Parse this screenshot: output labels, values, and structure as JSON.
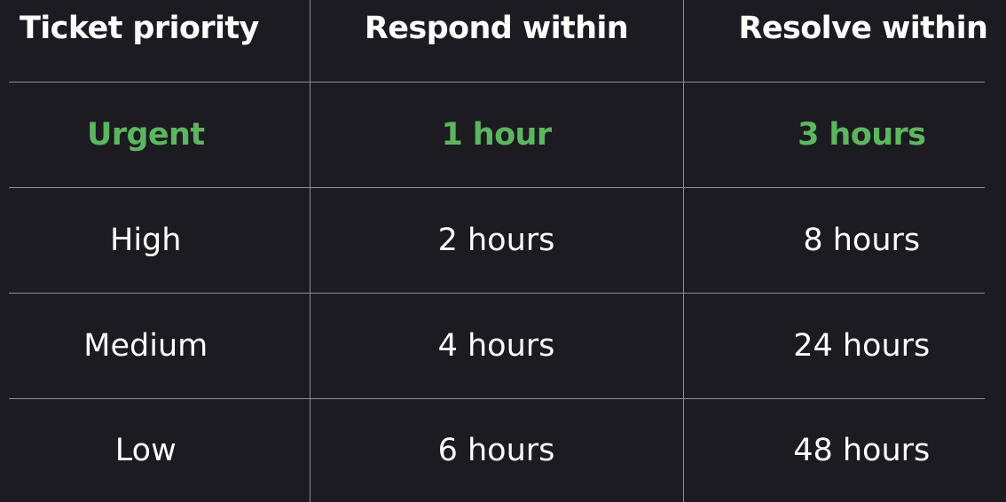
{
  "table": {
    "headers": [
      "Ticket priority",
      "Respond within",
      "Resolve within"
    ],
    "rows": [
      [
        "Urgent",
        "1 hour",
        "3 hours"
      ],
      [
        "High",
        "2 hours",
        "8 hours"
      ],
      [
        "Medium",
        "4 hours",
        "24 hours"
      ],
      [
        "Low",
        "6 hours",
        "48 hours"
      ]
    ]
  },
  "colors": {
    "background": "#1c1b21",
    "text": "#ffffff",
    "highlight": "#5cb65f",
    "grid": "#8e8d93"
  }
}
